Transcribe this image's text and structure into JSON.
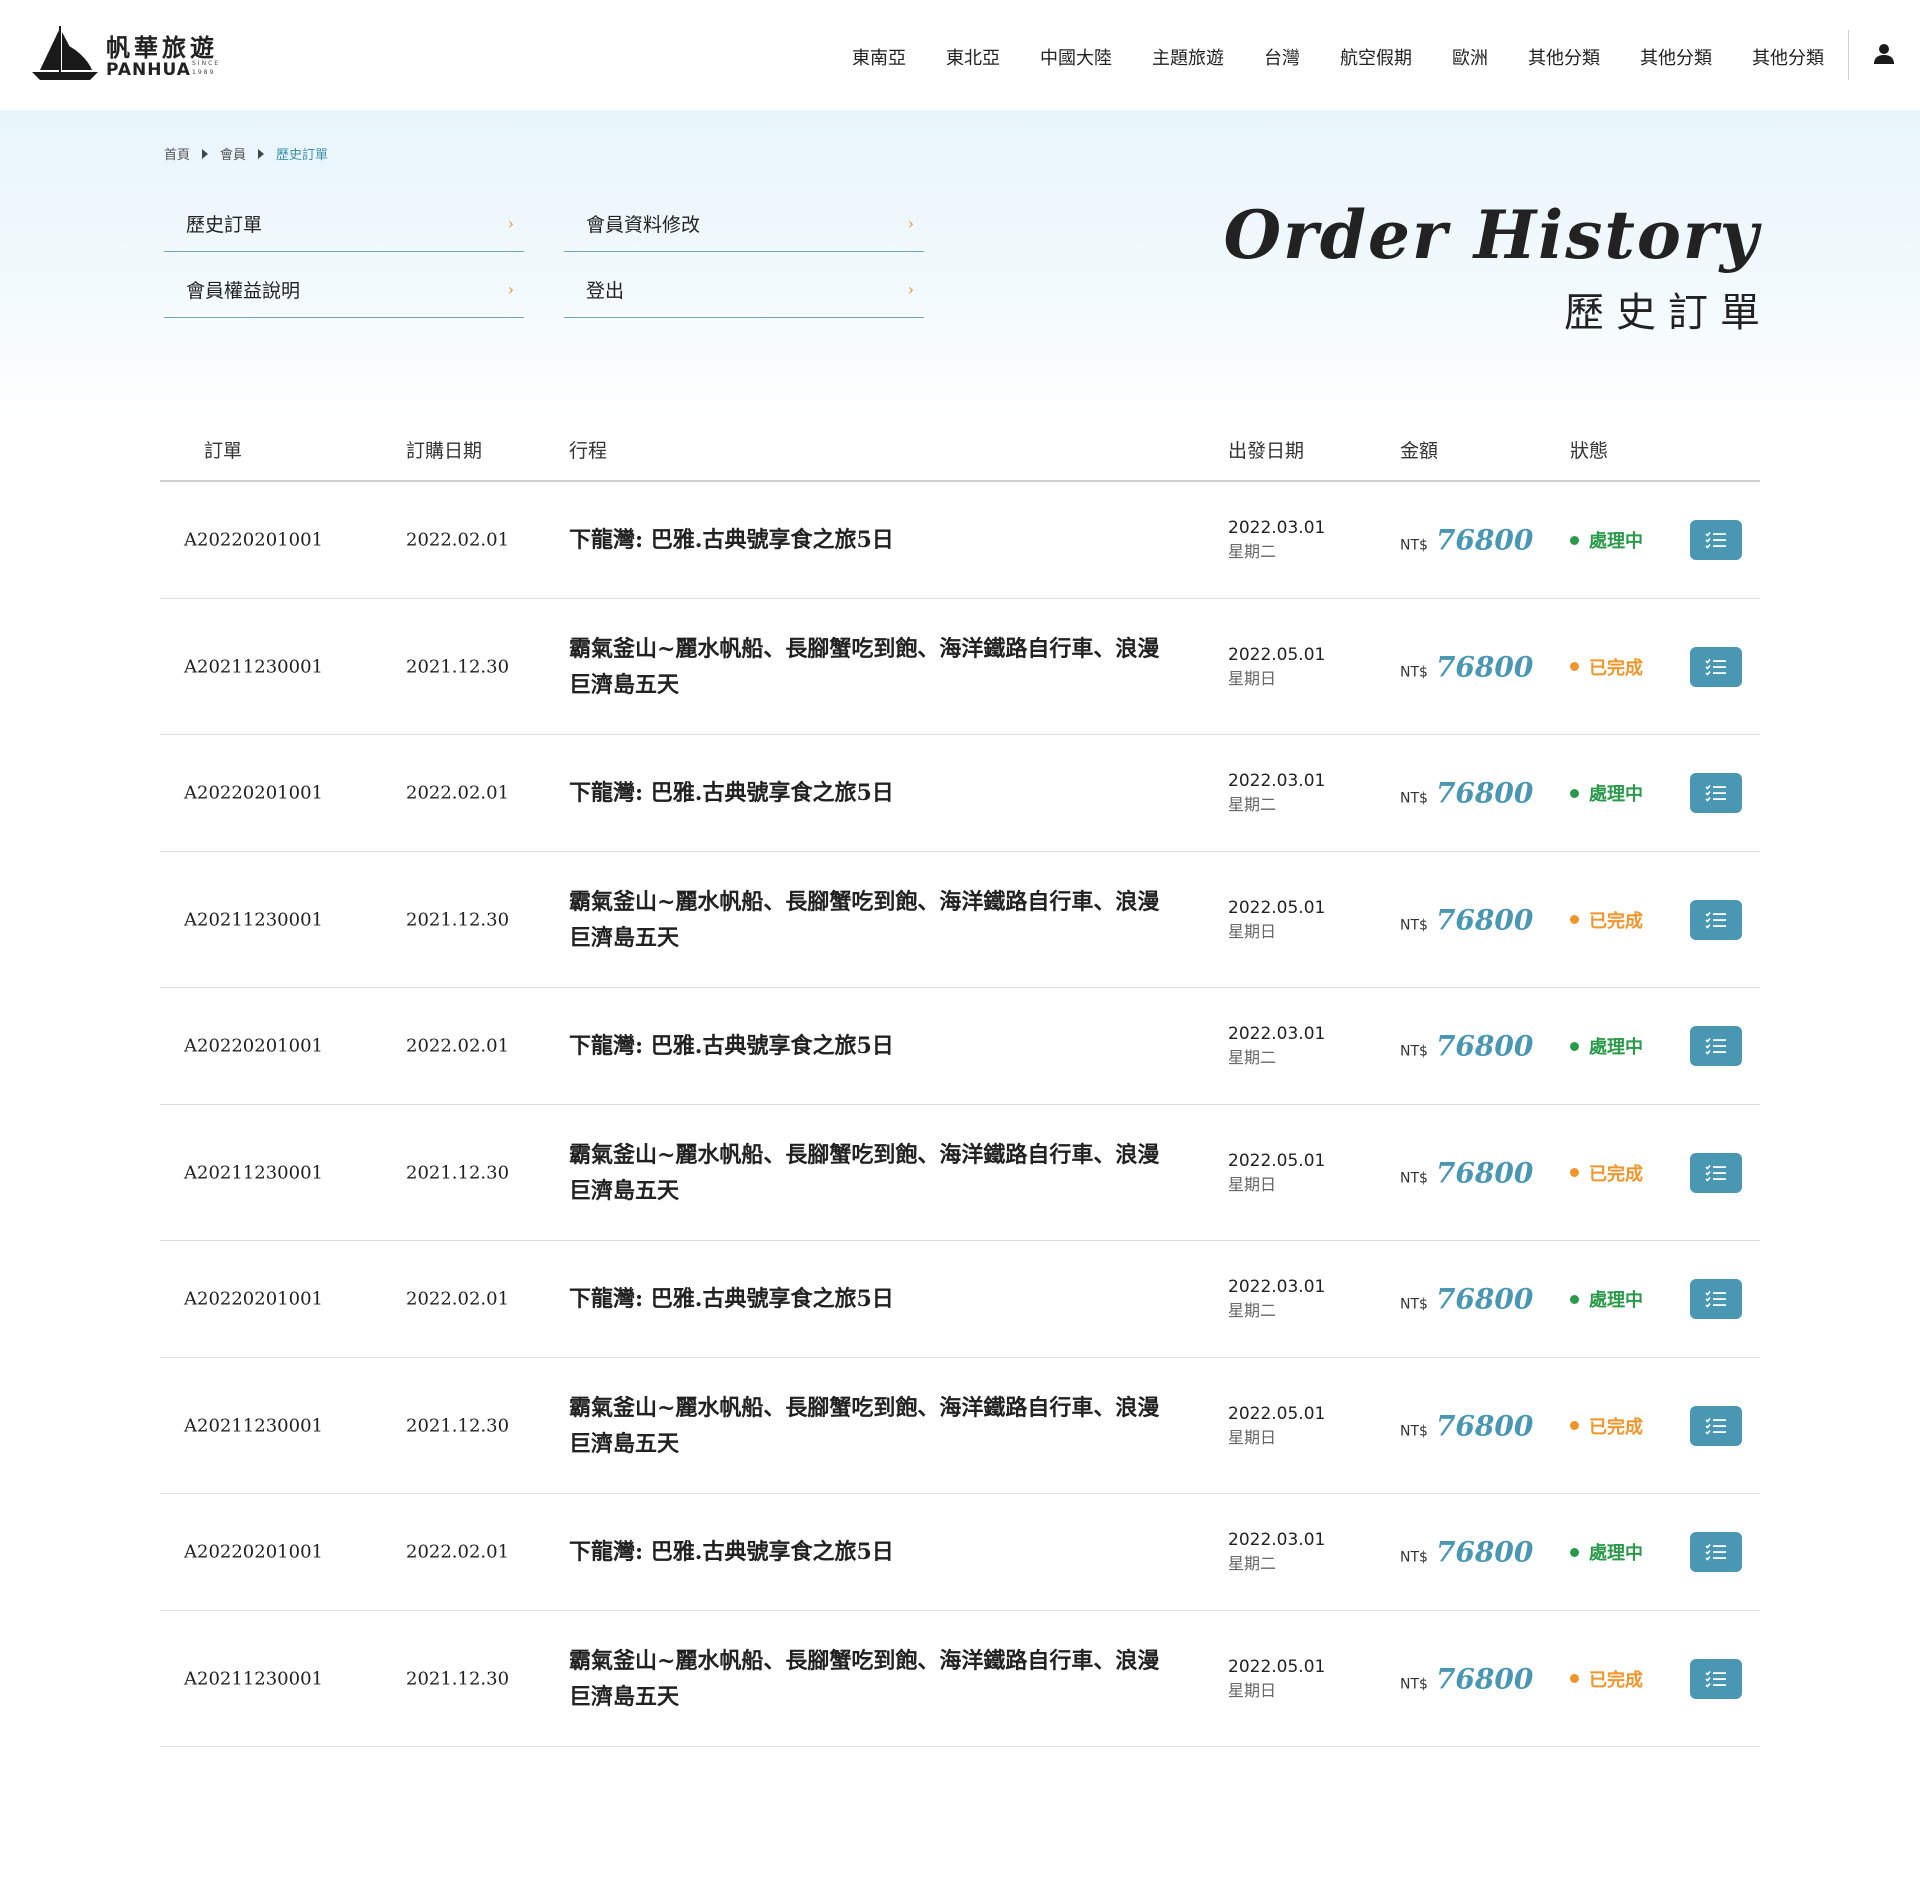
{
  "header": {
    "logo_zh": "帆華旅遊",
    "logo_en": "PANHUA",
    "logo_since": "SINCE 1989",
    "nav": [
      "東南亞",
      "東北亞",
      "中國大陸",
      "主題旅遊",
      "台灣",
      "航空假期",
      "歐洲",
      "其他分類",
      "其他分類",
      "其他分類"
    ]
  },
  "breadcrumb": [
    "首頁",
    "會員",
    "歷史訂單"
  ],
  "member_menu": [
    "歷史訂單",
    "會員資料修改",
    "會員權益說明",
    "登出"
  ],
  "page_title": {
    "en": "Order History",
    "zh": "歷史訂單"
  },
  "table": {
    "headers": [
      "訂單",
      "訂購日期",
      "行程",
      "出發日期",
      "金額",
      "狀態"
    ],
    "currency": "NT$",
    "rows": [
      {
        "order": "A20220201001",
        "date": "2022.02.01",
        "trip": "下龍灣: 巴雅.古典號享食之旅5日",
        "dep": "2022.03.01",
        "weekday": "星期二",
        "amount": "76800",
        "status": "處理中",
        "status_type": "processing"
      },
      {
        "order": "A20211230001",
        "date": "2021.12.30",
        "trip": "霸氣釜山~麗水帆船、長腳蟹吃到飽、海洋鐵路自行車、浪漫巨濟島五天",
        "dep": "2022.05.01",
        "weekday": "星期日",
        "amount": "76800",
        "status": "已完成",
        "status_type": "done"
      },
      {
        "order": "A20220201001",
        "date": "2022.02.01",
        "trip": "下龍灣: 巴雅.古典號享食之旅5日",
        "dep": "2022.03.01",
        "weekday": "星期二",
        "amount": "76800",
        "status": "處理中",
        "status_type": "processing"
      },
      {
        "order": "A20211230001",
        "date": "2021.12.30",
        "trip": "霸氣釜山~麗水帆船、長腳蟹吃到飽、海洋鐵路自行車、浪漫巨濟島五天",
        "dep": "2022.05.01",
        "weekday": "星期日",
        "amount": "76800",
        "status": "已完成",
        "status_type": "done"
      },
      {
        "order": "A20220201001",
        "date": "2022.02.01",
        "trip": "下龍灣: 巴雅.古典號享食之旅5日",
        "dep": "2022.03.01",
        "weekday": "星期二",
        "amount": "76800",
        "status": "處理中",
        "status_type": "processing"
      },
      {
        "order": "A20211230001",
        "date": "2021.12.30",
        "trip": "霸氣釜山~麗水帆船、長腳蟹吃到飽、海洋鐵路自行車、浪漫巨濟島五天",
        "dep": "2022.05.01",
        "weekday": "星期日",
        "amount": "76800",
        "status": "已完成",
        "status_type": "done"
      },
      {
        "order": "A20220201001",
        "date": "2022.02.01",
        "trip": "下龍灣: 巴雅.古典號享食之旅5日",
        "dep": "2022.03.01",
        "weekday": "星期二",
        "amount": "76800",
        "status": "處理中",
        "status_type": "processing"
      },
      {
        "order": "A20211230001",
        "date": "2021.12.30",
        "trip": "霸氣釜山~麗水帆船、長腳蟹吃到飽、海洋鐵路自行車、浪漫巨濟島五天",
        "dep": "2022.05.01",
        "weekday": "星期日",
        "amount": "76800",
        "status": "已完成",
        "status_type": "done"
      },
      {
        "order": "A20220201001",
        "date": "2022.02.01",
        "trip": "下龍灣: 巴雅.古典號享食之旅5日",
        "dep": "2022.03.01",
        "weekday": "星期二",
        "amount": "76800",
        "status": "處理中",
        "status_type": "processing"
      },
      {
        "order": "A20211230001",
        "date": "2021.12.30",
        "trip": "霸氣釜山~麗水帆船、長腳蟹吃到飽、海洋鐵路自行車、浪漫巨濟島五天",
        "dep": "2022.05.01",
        "weekday": "星期日",
        "amount": "76800",
        "status": "已完成",
        "status_type": "done"
      }
    ]
  },
  "colors": {
    "accent": "#4a97b4",
    "processing": "#2a9a4a",
    "done": "#f0952a",
    "chevron": "#e8942a"
  },
  "icons": {
    "user": "user-icon",
    "detail": "list-check-icon",
    "chevron": "chevron-right-icon",
    "breadcrumb_sep": "caret-right-icon"
  }
}
